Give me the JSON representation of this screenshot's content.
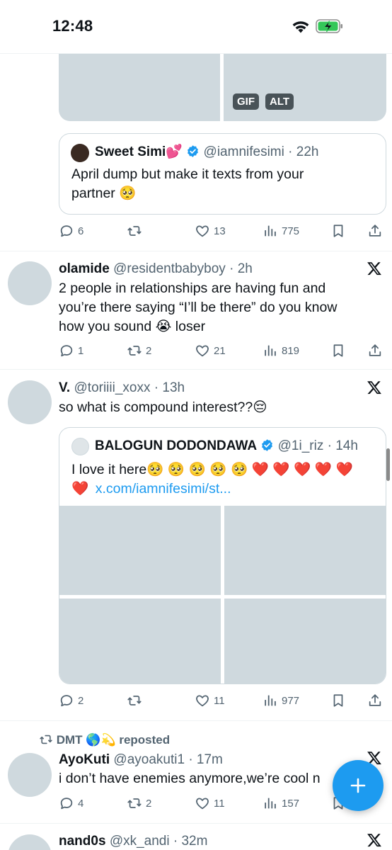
{
  "status_bar": {
    "time": "12:48"
  },
  "tweet0": {
    "badges": {
      "gif": "GIF",
      "alt": "ALT"
    },
    "quote": {
      "name": "Sweet Simi💕",
      "handle": "@iamnifesimi",
      "time": "· 22h",
      "text_line1": "April dump but make it texts from your",
      "text_line2": "partner 🥺"
    },
    "actions": {
      "replies": "6",
      "reposts": "",
      "likes": "13",
      "views": "775"
    }
  },
  "tweet1": {
    "name": "olamide",
    "handle": "@residentbabyboy",
    "time": "· 2h",
    "text_line1": "2 people in relationships are having fun and",
    "text_line2": "you’re there saying “I’ll be there” do you know",
    "text_line3": "how you sound 😭  loser",
    "actions": {
      "replies": "1",
      "reposts": "2",
      "likes": "21",
      "views": "819"
    }
  },
  "tweet2": {
    "name": "V.",
    "handle": "@toriiii_xoxx",
    "time": "· 13h",
    "text_line1": "so what is compound interest??😔",
    "quote": {
      "name": "BALOGUN DODONDAWA",
      "handle": "@1i_riz",
      "time": "· 14h",
      "text_line1": "I love it here🥺 🥺 🥺 🥺 🥺 ❤️ ❤️ ❤️ ❤️ ❤️",
      "text_line2_emoji": "❤️",
      "link": "x.com/iamnifesimi/st..."
    },
    "actions": {
      "replies": "2",
      "reposts": "",
      "likes": "11",
      "views": "977"
    }
  },
  "tweet3": {
    "repost_label": "DMT 🌎💫 reposted",
    "name": "AyoKuti",
    "handle": "@ayoakuti1",
    "time": "· 17m",
    "text_line1": "i don’t have enemies anymore,we’re cool n",
    "actions": {
      "replies": "4",
      "reposts": "2",
      "likes": "11",
      "views": "157"
    }
  },
  "tweet4": {
    "name": "nand0s",
    "handle": "@xk_andi",
    "time": "· 32m"
  },
  "colors": {
    "accent": "#1d9bf0",
    "secondary_text": "#536471",
    "placeholder": "#cfd9de"
  },
  "icons": [
    "wifi-icon",
    "battery-charging-icon",
    "reply-icon",
    "repost-icon",
    "like-icon",
    "views-icon",
    "bookmark-icon",
    "share-icon",
    "x-logo-icon",
    "verified-icon",
    "compose-plus-icon"
  ]
}
